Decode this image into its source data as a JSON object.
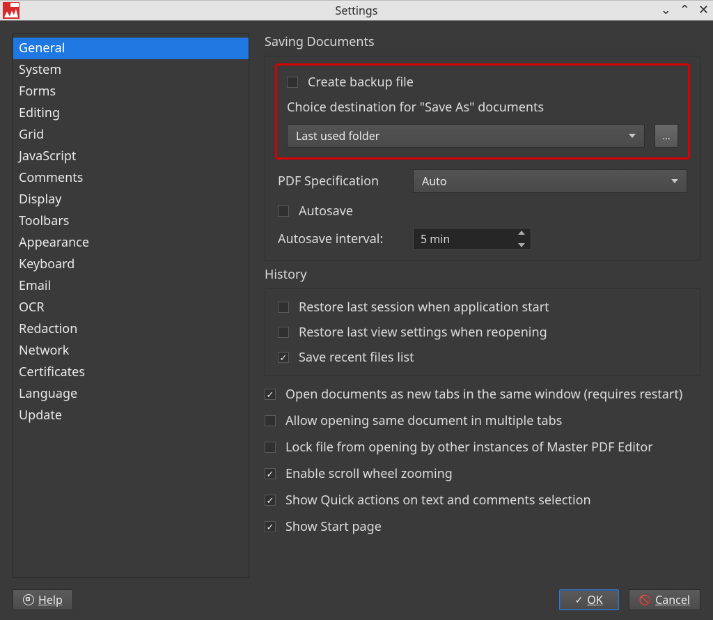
{
  "window": {
    "title": "Settings"
  },
  "sidebar": {
    "items": [
      "General",
      "System",
      "Forms",
      "Editing",
      "Grid",
      "JavaScript",
      "Comments",
      "Display",
      "Toolbars",
      "Appearance",
      "Keyboard",
      "Email",
      "OCR",
      "Redaction",
      "Network",
      "Certificates",
      "Language",
      "Update"
    ],
    "selected_index": 0
  },
  "saving": {
    "section_title": "Saving Documents",
    "create_backup": {
      "label": "Create backup file",
      "checked": false
    },
    "destination_label": "Choice destination for \"Save As\" documents",
    "destination_value": "Last used folder",
    "browse_label": "...",
    "pdf_spec_label": "PDF Specification",
    "pdf_spec_value": "Auto",
    "autosave": {
      "label": "Autosave",
      "checked": false
    },
    "autosave_interval_label": "Autosave interval:",
    "autosave_interval_value": "5 min"
  },
  "history": {
    "section_title": "History",
    "restore_session": {
      "label": "Restore last session when application start",
      "checked": false
    },
    "restore_view": {
      "label": "Restore last view settings when reopening",
      "checked": false
    },
    "save_recent": {
      "label": "Save recent files list",
      "checked": true
    }
  },
  "options": {
    "open_as_tabs": {
      "label": "Open documents as new tabs in the same window (requires restart)",
      "checked": true
    },
    "allow_multi_tabs": {
      "label": "Allow opening same document in multiple tabs",
      "checked": false
    },
    "lock_file": {
      "label": "Lock file from opening by other instances of Master PDF Editor",
      "checked": false
    },
    "scroll_zoom": {
      "label": "Enable scroll wheel zooming",
      "checked": true
    },
    "quick_actions": {
      "label": "Show Quick actions on text and comments selection",
      "checked": true
    },
    "start_page": {
      "label": "Show Start page",
      "checked": true
    }
  },
  "footer": {
    "help": "Help",
    "ok": "OK",
    "cancel": "Cancel"
  }
}
